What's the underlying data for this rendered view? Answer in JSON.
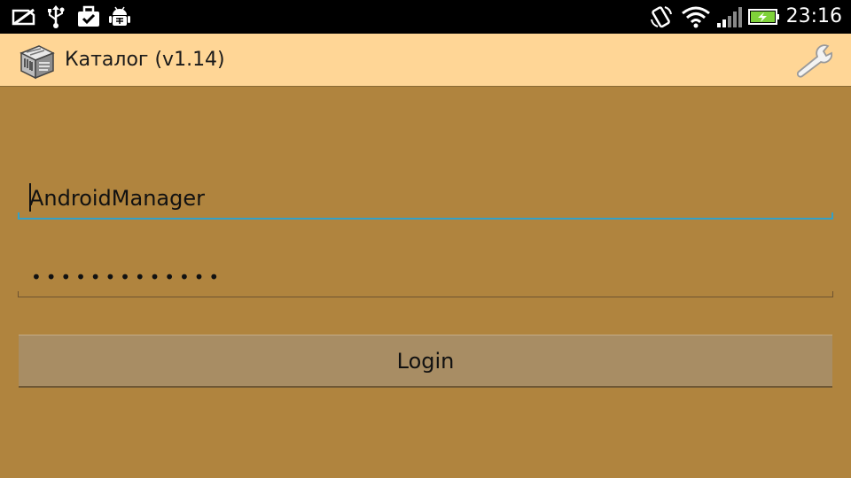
{
  "status_bar": {
    "time": "23:16",
    "icons": [
      "no-sim-card-icon",
      "usb-icon",
      "briefcase-check-icon",
      "android-debug-icon",
      "screen-rotation-icon",
      "wifi-icon",
      "signal-icon",
      "battery-charging-icon"
    ]
  },
  "action_bar": {
    "title": "Каталог (v1.14)",
    "logo_icon": "catalog-app-icon",
    "settings_icon": "wrench-icon"
  },
  "login_form": {
    "username_value": "AndroidManager",
    "password_value": "•••••••••••••",
    "login_button_label": "Login"
  },
  "colors": {
    "background": "#b0843e",
    "action_bar": "#ffd696",
    "focus_underline": "#33a0c8",
    "button": "#a88d64"
  }
}
